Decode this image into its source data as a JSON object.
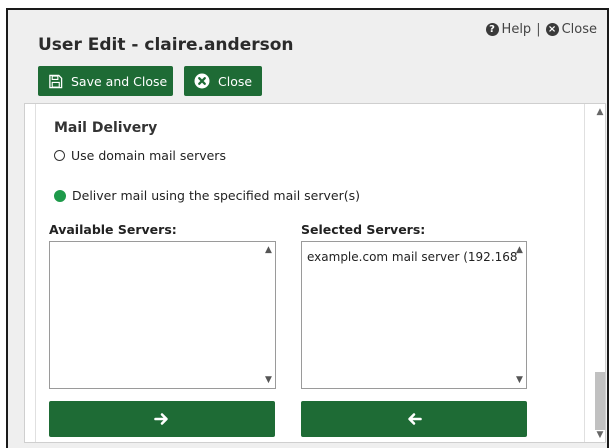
{
  "dialog": {
    "title": "User Edit - claire.anderson",
    "help_label": "Help",
    "close_link_label": "Close",
    "separator": "|"
  },
  "toolbar": {
    "save_close_label": "Save and Close",
    "close_label": "Close"
  },
  "mail_delivery": {
    "section_title": "Mail Delivery",
    "options": [
      {
        "label": "Use domain mail servers",
        "selected": false
      },
      {
        "label": "Deliver mail using the specified mail server(s)",
        "selected": true
      }
    ]
  },
  "servers": {
    "available_label": "Available Servers:",
    "available_items": [],
    "selected_label": "Selected Servers:",
    "selected_items": [
      "example.com mail server (192.168."
    ],
    "add_arrow": "➔",
    "remove_arrow": "🡐"
  },
  "icons": {
    "help": "question-circle-icon",
    "close": "close-circle-icon",
    "save": "floppy-disk-icon",
    "close_button": "close-circle-icon",
    "move_right": "arrow-right-icon",
    "move_left": "arrow-left-icon"
  },
  "colors": {
    "primary_button": "#1e6b35",
    "radio_selected": "#1e9a4a",
    "dialog_bg": "#efefef"
  }
}
